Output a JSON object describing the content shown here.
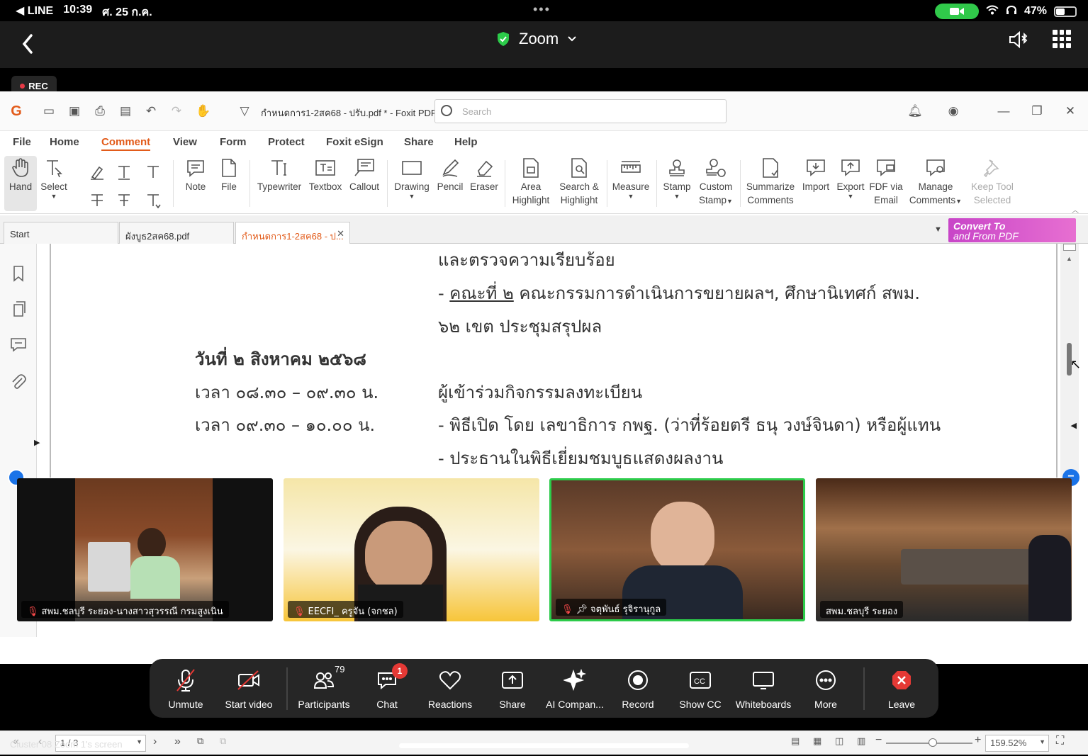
{
  "status": {
    "back_app": "◀ LINE",
    "time": "10:39",
    "date": "ศ. 25 ก.ค.",
    "battery": "47%",
    "battery_level": 0.47
  },
  "zoom_header": {
    "title": "Zoom",
    "rec": "REC"
  },
  "foxit": {
    "doc_title": "กำหนดการ1-2สค68 - ปรับ.pdf * - Foxit PDF ...",
    "search_placeholder": "Search",
    "menu": [
      "File",
      "Home",
      "Comment",
      "View",
      "Form",
      "Protect",
      "Foxit eSign",
      "Share",
      "Help"
    ],
    "active_menu": "Comment",
    "tools": {
      "hand": "Hand",
      "select": "Select",
      "note": "Note",
      "file": "File",
      "typewriter": "Typewriter",
      "textbox": "Textbox",
      "callout": "Callout",
      "drawing": "Drawing",
      "pencil": "Pencil",
      "eraser": "Eraser",
      "area_highlight_1": "Area",
      "area_highlight_2": "Highlight",
      "search_highlight_1": "Search &",
      "search_highlight_2": "Highlight",
      "measure": "Measure",
      "stamp": "Stamp",
      "custom_stamp_1": "Custom",
      "custom_stamp_2": "Stamp",
      "summarize_1": "Summarize",
      "summarize_2": "Comments",
      "import": "Import",
      "export": "Export",
      "fdf_1": "FDF via",
      "fdf_2": "Email",
      "manage_1": "Manage",
      "manage_2": "Comments",
      "keep_1": "Keep Tool",
      "keep_2": "Selected"
    },
    "tabs": [
      "Start",
      "ผังบูธ2สค68.pdf",
      "กำหนดการ1-2สค68 - ป..."
    ],
    "convert_1": "Convert To",
    "convert_2": "and From PDF",
    "page_lines": {
      "l1": "และตรวจความเรียบร้อย",
      "l2_prefix": "- ",
      "l2_underlined": "คณะที่ ๒",
      "l2_rest": " คณะกรรมการดำเนินการขยายผลฯ, ศึกษานิเทศก์ สพม.",
      "l3": "๖๒ เขต ประชุมสรุปผล",
      "date_heading": "วันที่ ๒ สิงหาคม ๒๕๖๘",
      "time1": "เวลา ๐๘.๓๐ – ๐๙.๓๐ น.",
      "act1": "ผู้เข้าร่วมกิจกรรมลงทะเบียน",
      "time2": "เวลา ๐๙.๓๐ – ๑๐.๐๐ น.",
      "act2": "- พิธีเปิด โดย เลขาธิการ กพฐ. (ว่าที่ร้อยตรี ธนุ วงษ์จินดา) หรือผู้แทน",
      "act3": "- ประธานในพิธีเยี่ยมชมบูธแสดงผลงาน"
    },
    "page_indicator": "1 / 3",
    "zoom_level": "159.52%"
  },
  "participants_video": [
    {
      "name": "สพม.ชลบุรี ระยอง-นางสาวสุวรรณี กรมสูงเนิน",
      "muted": true
    },
    {
      "name": "EECFI_ ครูจัน (จกชล)",
      "muted": true
    },
    {
      "name": "จตุพันธ์ รุจิรานุกูล",
      "muted": true,
      "pinned": true
    },
    {
      "name": "สพม.ชลบุรี ระยอง",
      "muted": false
    }
  ],
  "controls": {
    "unmute": "Unmute",
    "start_video": "Start video",
    "participants": "Participants",
    "participants_count": "79",
    "chat": "Chat",
    "chat_badge": "1",
    "reactions": "Reactions",
    "share": "Share",
    "ai": "AI Compan...",
    "record": "Record",
    "show_cc": "Show CC",
    "whiteboards": "Whiteboards",
    "more": "More",
    "leave": "Leave"
  },
  "footer": "Cluster 08 Zoom 1's screen",
  "colors": {
    "accent": "#e25b1a",
    "speaking": "#2ccb4a",
    "leave": "#e53935"
  }
}
